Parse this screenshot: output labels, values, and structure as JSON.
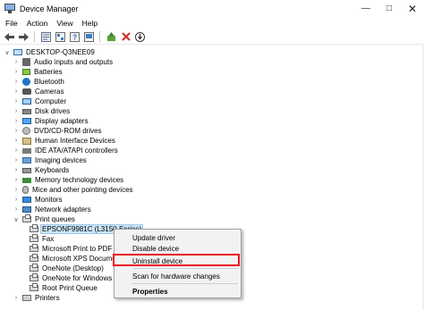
{
  "window": {
    "title": "Device Manager"
  },
  "menubar": [
    "File",
    "Action",
    "View",
    "Help"
  ],
  "toolbar": {
    "buttons": [
      "back-arrow-icon",
      "forward-arrow-icon",
      "properties-icon",
      "show-hidden-icon",
      "help-icon",
      "view-icon",
      "update-driver-icon",
      "uninstall-x-icon",
      "download-driver-icon"
    ]
  },
  "tree": {
    "root": "DESKTOP-Q3NEE09",
    "categories": [
      "Audio inputs and outputs",
      "Batteries",
      "Bluetooth",
      "Cameras",
      "Computer",
      "Disk drives",
      "Display adapters",
      "DVD/CD-ROM drives",
      "Human Interface Devices",
      "IDE ATA/ATAPI controllers",
      "Imaging devices",
      "Keyboards",
      "Memory technology devices",
      "Mice and other pointing devices",
      "Monitors",
      "Network adapters",
      "Print queues"
    ],
    "print_queue_children": [
      "EPSONF9981C (L3150 Series)",
      "Fax",
      "Microsoft Print to PDF",
      "Microsoft XPS Docume",
      "OneNote (Desktop)",
      "OneNote for Windows",
      "Root Print Queue"
    ],
    "after": "Printers"
  },
  "context_menu": {
    "items": [
      "Update driver",
      "Disable device",
      "Uninstall device",
      "Scan for hardware changes",
      "Properties"
    ],
    "highlighted": "Uninstall device"
  },
  "colors": {
    "highlight_box": "#e81123",
    "selection": "#cce4f7"
  }
}
